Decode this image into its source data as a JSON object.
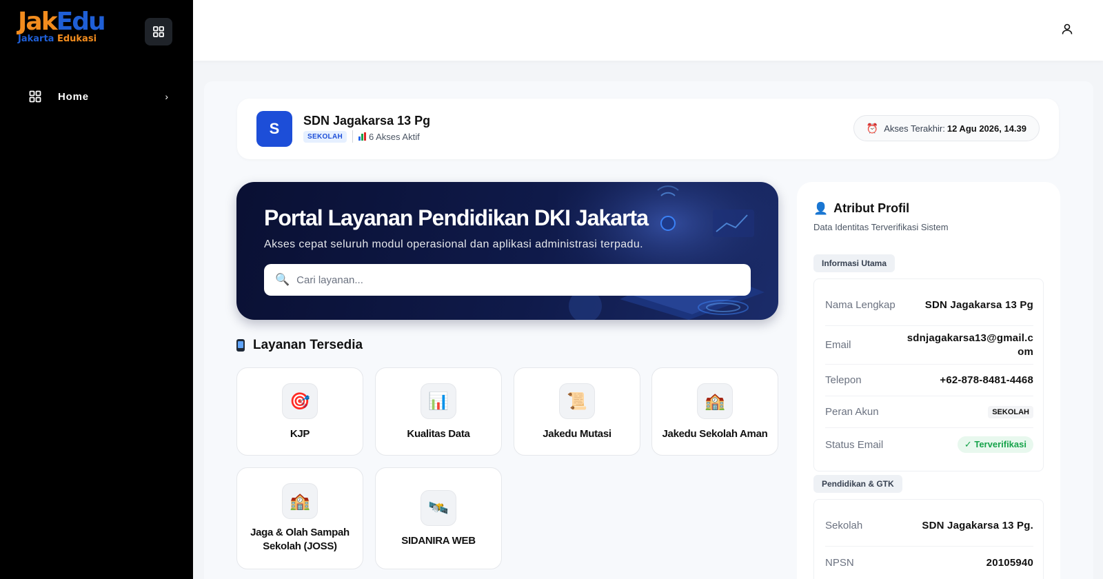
{
  "brand": {
    "logo_part1": "Jak",
    "logo_part2": "Edu",
    "logo_sub1": "Jakarta",
    "logo_sub2": "Edukasi",
    "accent_orange": "#f28c1e",
    "accent_blue": "#1f5fd6"
  },
  "sidebar": {
    "toggle_icon": "grid-icon",
    "items": [
      {
        "label": "Home",
        "icon": "grid-icon"
      }
    ]
  },
  "header": {
    "user_icon": "user-icon"
  },
  "school": {
    "avatar_letter": "S",
    "name": "SDN Jagakarsa 13 Pg",
    "role_badge": "SEKOLAH",
    "active_access": "6 Akses Aktif",
    "last_access_label": "Akses Terakhir:",
    "last_access_value": "12 Agu 2026, 14.39"
  },
  "hero": {
    "title": "Portal Layanan Pendidikan DKI Jakarta",
    "subtitle": "Akses cepat seluruh modul operasional dan aplikasi administrasi terpadu.",
    "search_placeholder": "Cari layanan..."
  },
  "services": {
    "title": "Layanan Tersedia",
    "items": [
      {
        "label": "KJP",
        "icon": "target-icon"
      },
      {
        "label": "Kualitas Data",
        "icon": "bar-chart-icon"
      },
      {
        "label": "Jakedu Mutasi",
        "icon": "scroll-icon"
      },
      {
        "label": "Jakedu Sekolah Aman",
        "icon": "school-icon"
      },
      {
        "label": "Jaga & Olah Sampah Sekolah (JOSS)",
        "icon": "school-icon"
      },
      {
        "label": "SIDANIRA WEB",
        "icon": "satellite-icon"
      }
    ]
  },
  "profile": {
    "title": "Atribut Profil",
    "subtitle": "Data Identitas Terverifikasi Sistem",
    "group1_label": "Informasi Utama",
    "group2_label": "Pendidikan & GTK",
    "nama_label": "Nama Lengkap",
    "nama_value": "SDN Jagakarsa 13 Pg",
    "email_label": "Email",
    "email_value": "sdnjagakarsa13@gmail.com",
    "telepon_label": "Telepon",
    "telepon_value": "+62-878-8481-4468",
    "peran_label": "Peran Akun",
    "peran_value": "SEKOLAH",
    "status_label": "Status Email",
    "status_value": "✓ Terverifikasi",
    "sekolah_label": "Sekolah",
    "sekolah_value": "SDN Jagakarsa 13 Pg.",
    "npsn_label": "NPSN",
    "npsn_value": "20105940"
  }
}
